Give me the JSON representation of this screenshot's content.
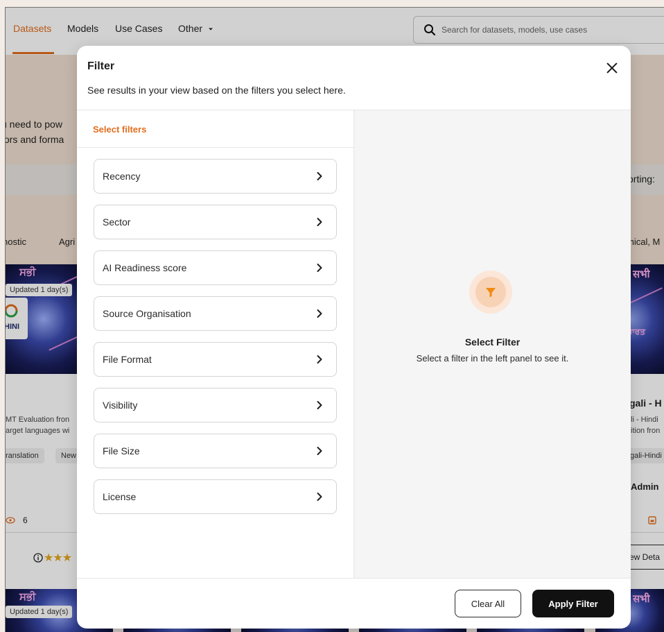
{
  "nav": {
    "datasets": "Datasets",
    "models": "Models",
    "use_cases": "Use Cases",
    "other": "Other"
  },
  "search": {
    "placeholder": "Search for datasets, models, use cases"
  },
  "background": {
    "hero_line1": "u need to pow",
    "hero_line2": "tors and forma",
    "sorting": "orting:",
    "category_left_1": "nostic",
    "category_left_2": "Agri",
    "category_right": "mical, M",
    "left_card": {
      "updated": "Updated 1 day(s)",
      "logo": "HINI",
      "desc_line1": "MT Evaluation fron",
      "desc_line2": "arget languages wi",
      "tag1": "ranslation",
      "tag2": "New",
      "views": "6"
    },
    "right_card": {
      "title": "gali - H",
      "desc_line1": "li - Hindi",
      "desc_line2": "ition fron",
      "tag": "gali-Hindi",
      "owner": "Admin",
      "details_button": "ew Deta"
    },
    "bottom_left_updated": "Updated 1 day(s)",
    "deva_1": "सभी",
    "deva_2": "ਸਭੀ"
  },
  "modal": {
    "title": "Filter",
    "subtitle": "See results in your view based on the filters you select here.",
    "select_filters_label": "Select filters",
    "filters": [
      {
        "label": "Recency"
      },
      {
        "label": "Sector"
      },
      {
        "label": "AI Readiness score"
      },
      {
        "label": "Source Organisation"
      },
      {
        "label": "File Format"
      },
      {
        "label": "Visibility"
      },
      {
        "label": "File Size"
      },
      {
        "label": "License"
      }
    ],
    "empty_state": {
      "title": "Select Filter",
      "description": "Select a filter in the left panel to see it."
    },
    "clear_button": "Clear All",
    "apply_button": "Apply Filter"
  },
  "colors": {
    "accent": "#e16d1d",
    "apply_button_bg": "#111111"
  }
}
